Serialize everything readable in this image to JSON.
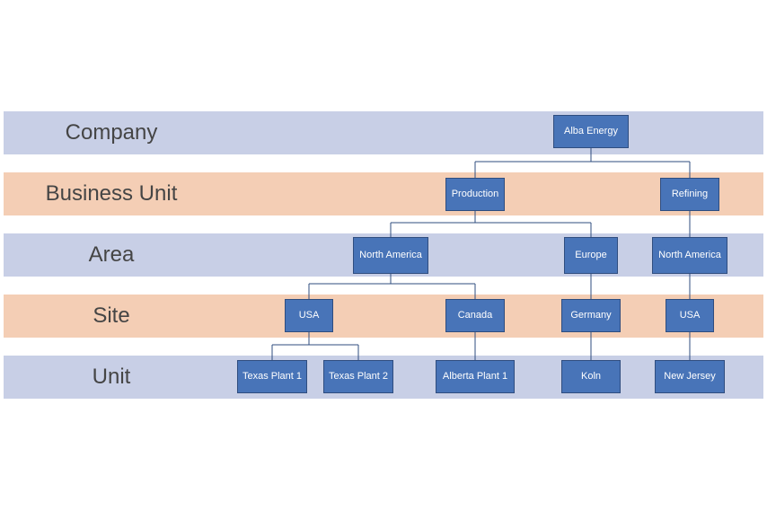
{
  "levels": {
    "company": "Company",
    "business_unit": "Business Unit",
    "area": "Area",
    "site": "Site",
    "unit": "Unit"
  },
  "nodes": {
    "root": "Alba Energy",
    "bu_production": "Production",
    "bu_refining": "Refining",
    "area_prod_na": "North America",
    "area_prod_eu": "Europe",
    "area_ref_na": "North America",
    "site_usa1": "USA",
    "site_canada": "Canada",
    "site_germany": "Germany",
    "site_usa2": "USA",
    "unit_tx1": "Texas Plant 1",
    "unit_tx2": "Texas Plant 2",
    "unit_ab1": "Alberta Plant 1",
    "unit_koln": "Koln",
    "unit_nj": "New Jersey"
  },
  "colors": {
    "node_fill": "#4874b8",
    "node_border": "#2f4d7f",
    "band_blue": "#c8cfe6",
    "band_peach": "#f4ceb5"
  }
}
